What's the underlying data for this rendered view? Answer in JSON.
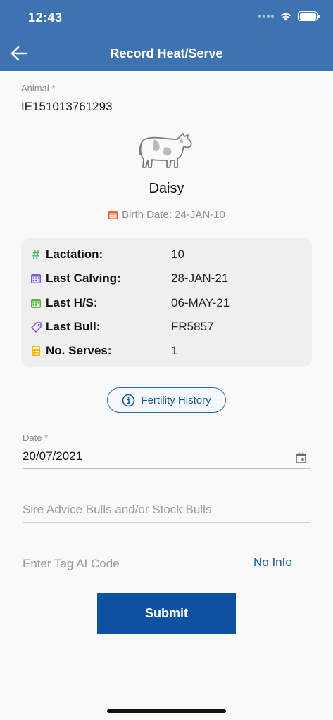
{
  "status_bar": {
    "time": "12:43"
  },
  "header": {
    "title": "Record Heat/Serve"
  },
  "animal_field": {
    "label": "Animal *",
    "value": "IE151013761293"
  },
  "animal": {
    "name": "Daisy",
    "birth_date": "Birth Date: 24-JAN-10"
  },
  "info": {
    "rows": [
      {
        "icon": "hash-icon",
        "label": "Lactation:",
        "value": "10"
      },
      {
        "icon": "calendar-icon",
        "label": "Last Calving:",
        "value": "28-JAN-21"
      },
      {
        "icon": "calendar-icon",
        "label": "Last H/S:",
        "value": "06-MAY-21"
      },
      {
        "icon": "tag-icon",
        "label": "Last Bull:",
        "value": "FR5857"
      },
      {
        "icon": "calculator-icon",
        "label": "No. Serves:",
        "value": "1"
      }
    ]
  },
  "fertility_button": {
    "label": "Fertility History"
  },
  "date_field": {
    "label": "Date *",
    "value": "20/07/2021"
  },
  "sire_field": {
    "placeholder": "Sire Advice Bulls and/or Stock Bulls"
  },
  "tag_field": {
    "placeholder": "Enter Tag AI Code"
  },
  "no_info": {
    "label": "No Info"
  },
  "submit": {
    "label": "Submit"
  },
  "colors": {
    "header": "#3d73b1",
    "accent": "#0d52a0",
    "card": "#efefef"
  }
}
